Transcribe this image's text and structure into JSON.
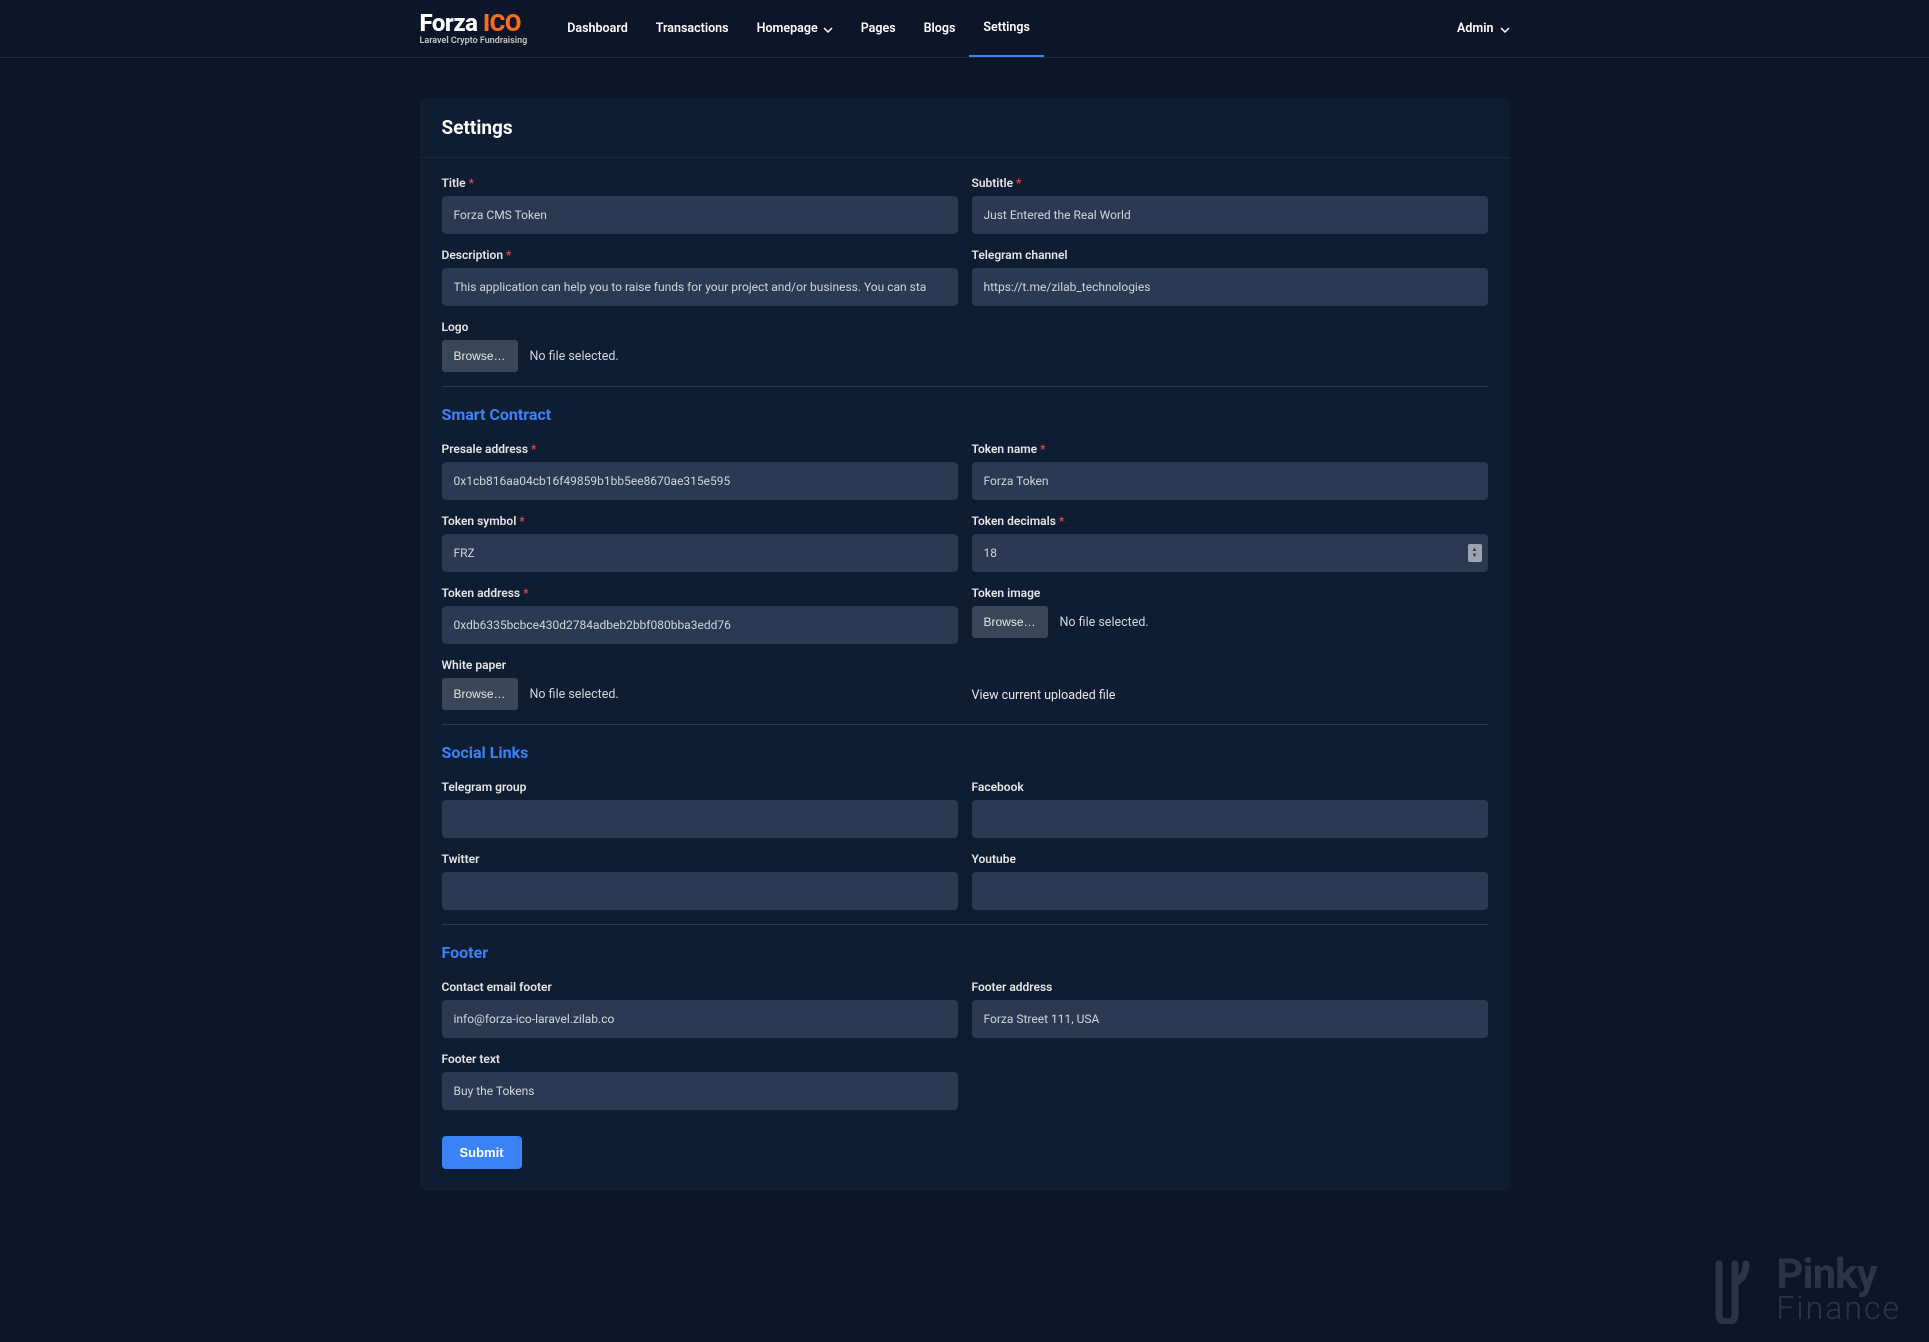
{
  "brand": {
    "name_a": "Forza",
    "name_b": "ICO",
    "tagline": "Laravel Crypto Fundraising"
  },
  "nav": {
    "items": [
      "Dashboard",
      "Transactions",
      "Homepage",
      "Pages",
      "Blogs",
      "Settings"
    ],
    "active_index": 5
  },
  "user": {
    "name": "Admin"
  },
  "page": {
    "title": "Settings"
  },
  "labels": {
    "title": "Title",
    "subtitle": "Subtitle",
    "description": "Description",
    "telegram_channel": "Telegram channel",
    "logo": "Logo",
    "presale_address": "Presale address",
    "token_name": "Token name",
    "token_symbol": "Token symbol",
    "token_decimals": "Token decimals",
    "token_address": "Token address",
    "token_image": "Token image",
    "white_paper": "White paper",
    "telegram_group": "Telegram group",
    "facebook": "Facebook",
    "twitter": "Twitter",
    "youtube": "Youtube",
    "contact_email_footer": "Contact email footer",
    "footer_address": "Footer address",
    "footer_text": "Footer text"
  },
  "values": {
    "title": "Forza CMS Token",
    "subtitle": "Just Entered the Real World",
    "description": "This application can help you to raise funds for your project and/or business. You can sta",
    "telegram_channel": "https://t.me/zilab_technologies",
    "presale_address": "0x1cb816aa04cb16f49859b1bb5ee8670ae315e595",
    "token_name": "Forza Token",
    "token_symbol": "FRZ",
    "token_decimals": "18",
    "token_address": "0xdb6335bcbce430d2784adbeb2bbf080bba3edd76",
    "telegram_group": "",
    "facebook": "",
    "twitter": "",
    "youtube": "",
    "contact_email_footer": "info@forza-ico-laravel.zilab.co",
    "footer_address": "Forza Street 111, USA",
    "footer_text": "Buy the Tokens"
  },
  "ui": {
    "browse": "Browse…",
    "no_file": "No file selected.",
    "view_uploaded": "View current uploaded file",
    "submit": "Submit",
    "required_mark": "*"
  },
  "sections": {
    "smart_contract": "Smart Contract",
    "social_links": "Social Links",
    "footer": "Footer"
  },
  "watermark": {
    "line1": "Pinky",
    "line2": "Finance"
  }
}
